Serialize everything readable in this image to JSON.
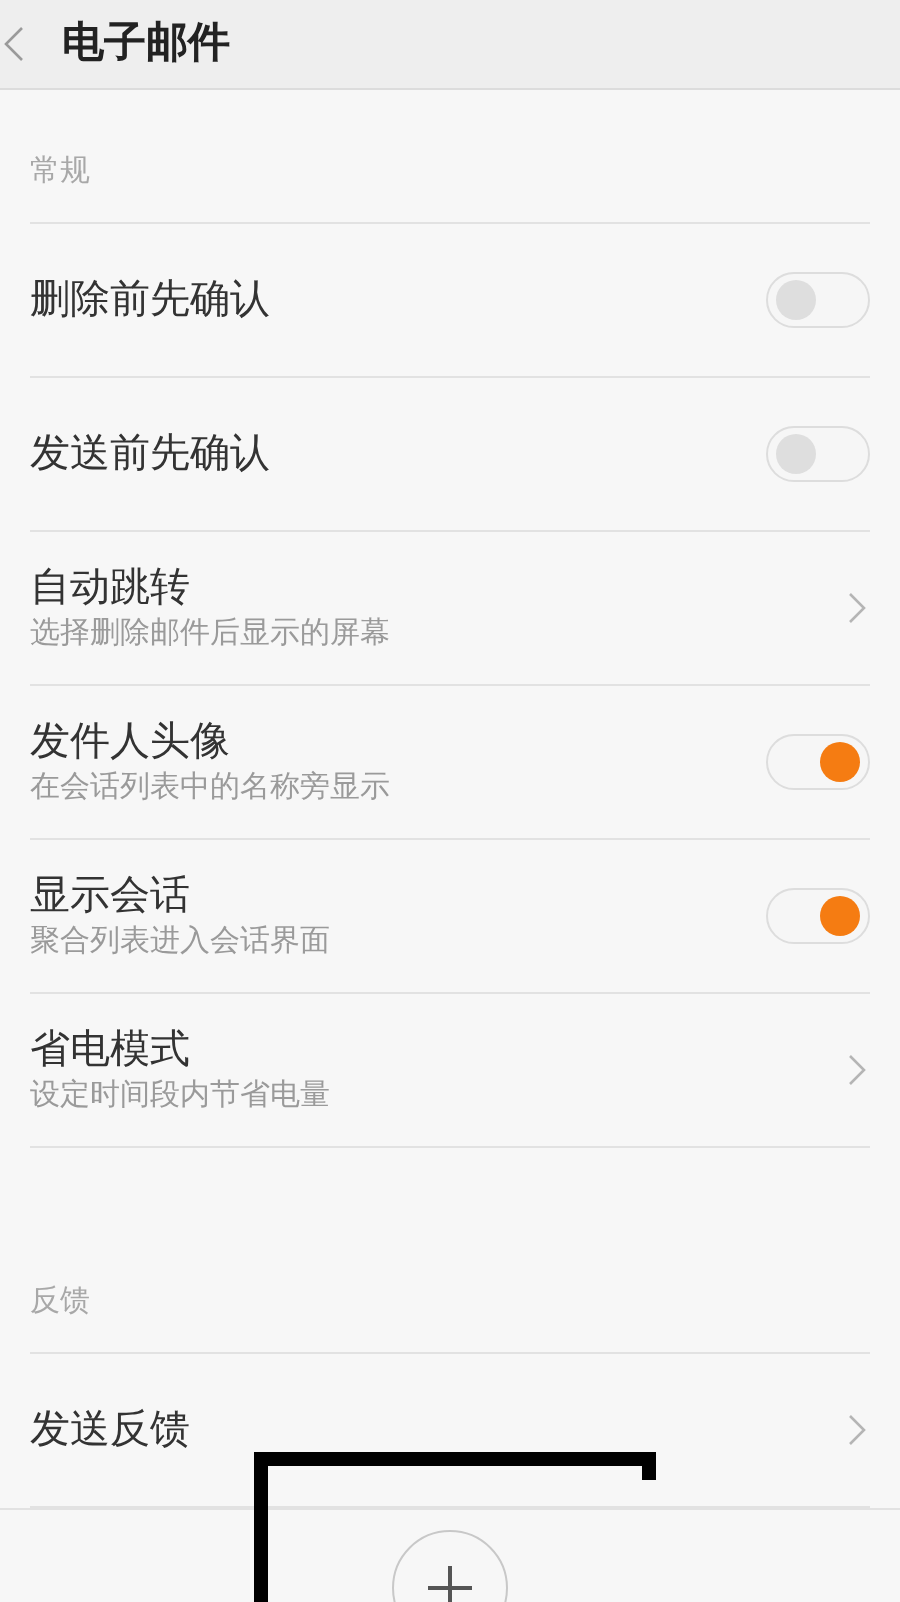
{
  "header": {
    "title": "电子邮件"
  },
  "sections": [
    {
      "title": "常规",
      "items": [
        {
          "kind": "toggle",
          "label": "删除前先确认",
          "on": false
        },
        {
          "kind": "toggle",
          "label": "发送前先确认",
          "on": false
        },
        {
          "kind": "link",
          "label": "自动跳转",
          "subtitle": "选择删除邮件后显示的屏幕"
        },
        {
          "kind": "toggle",
          "label": "发件人头像",
          "subtitle": "在会话列表中的名称旁显示",
          "on": true
        },
        {
          "kind": "toggle",
          "label": "显示会话",
          "subtitle": "聚合列表进入会话界面",
          "on": true
        },
        {
          "kind": "link",
          "label": "省电模式",
          "subtitle": "设定时间段内节省电量"
        }
      ]
    },
    {
      "title": "反馈",
      "items": [
        {
          "kind": "link",
          "label": "发送反馈"
        }
      ]
    }
  ],
  "bottom_bar": {
    "highlighted": true
  }
}
